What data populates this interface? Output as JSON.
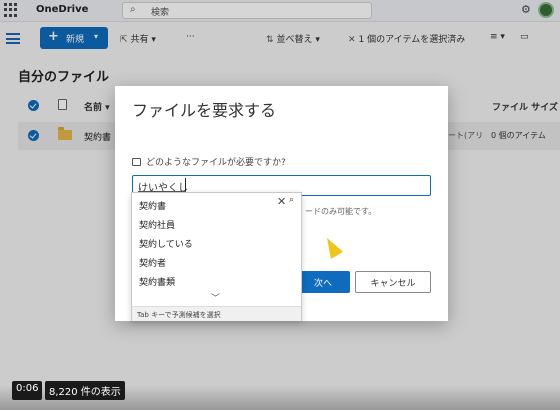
{
  "header": {
    "app_name": "OneDrive",
    "search_placeholder": "検索"
  },
  "commandbar": {
    "new_label": "新規",
    "share_label": "共有",
    "more_label": "···",
    "sort_label": "並べ替え",
    "selection_label": "1 個のアイテムを選択済み"
  },
  "main": {
    "heading": "自分のファイル",
    "columns": {
      "name": "名前",
      "size": "ファイル サイズ"
    },
    "row": {
      "name": "契約書",
      "share": "ート(アリ",
      "count": "0 個のアイテム"
    }
  },
  "dialog": {
    "title": "ファイルを要求する",
    "question": "どのようなファイルが必要ですか?",
    "input_value": "けいやくし",
    "hint": "ードのみ可能です。",
    "ok_label": "次へ",
    "cancel_label": "キャンセル"
  },
  "ime": {
    "candidates": [
      "契約書",
      "契約社員",
      "契約している",
      "契約者",
      "契約書類"
    ],
    "footer": "Tab キーで予測候補を選択"
  },
  "video": {
    "timestamp": "0:06",
    "item_count": "8,220 件の表示"
  },
  "colors": {
    "accent": "#0f6cbd",
    "cursor": "#f0c419"
  },
  "icons": [
    "waffle-icon",
    "search-icon",
    "settings-icon",
    "hamburger-icon",
    "share-icon",
    "sort-icon",
    "close-icon",
    "view-icon",
    "folder-icon",
    "file-icon",
    "cursor-icon"
  ]
}
